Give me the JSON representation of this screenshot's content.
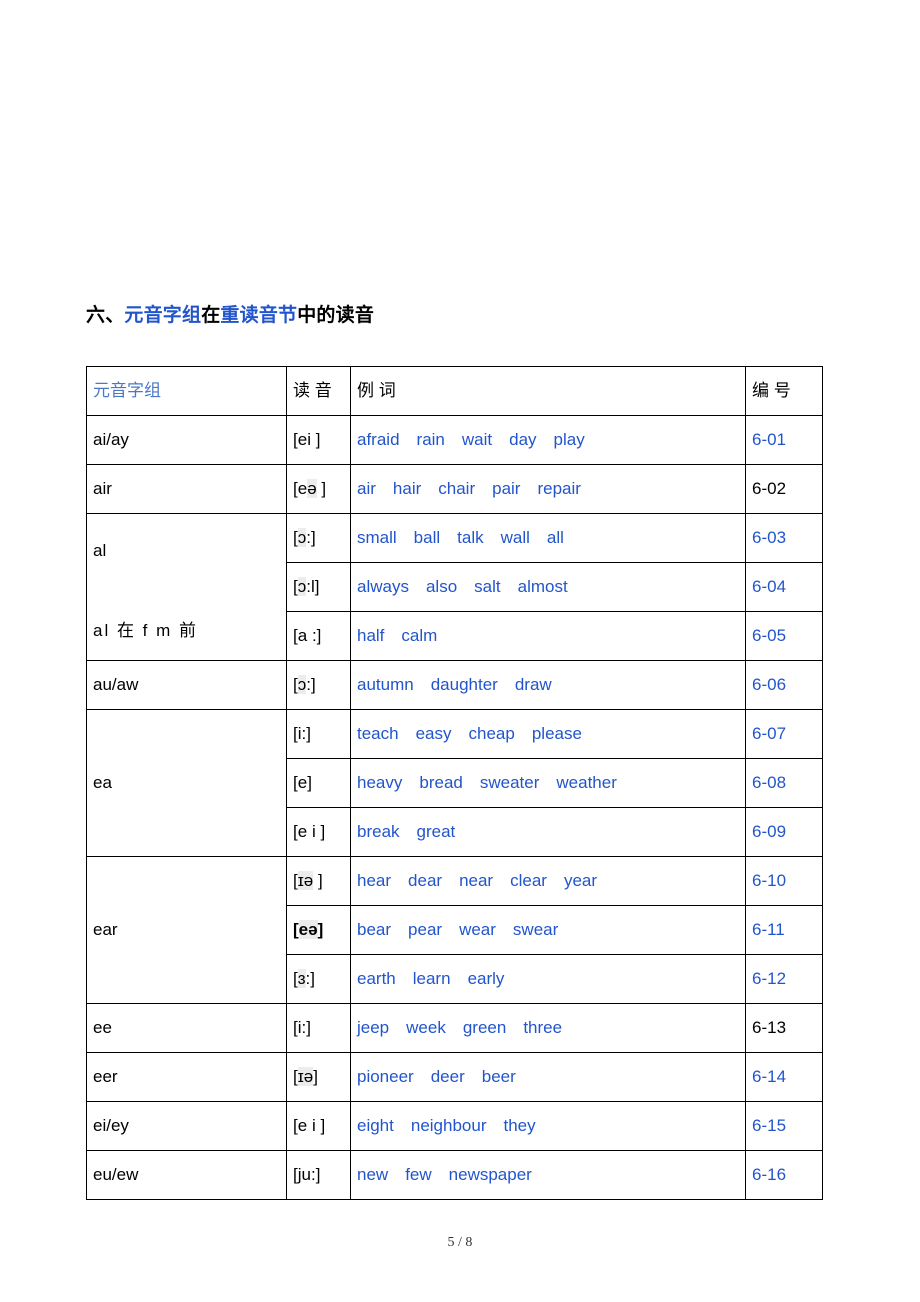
{
  "heading": {
    "prefix": "六、",
    "part1_blue": "元音字组",
    "part2_black": "在",
    "part3_blue": "重读音节",
    "part4_black": "中的读音"
  },
  "table": {
    "headers": {
      "group": "元音字组",
      "sound": "读 音",
      "words": "例 词",
      "code": "编 号"
    },
    "rows": [
      {
        "group": "ai/ay",
        "group_rowspan": 1,
        "sound": "[ei ]",
        "sound_highlight": "",
        "words": [
          "afraid",
          "rain",
          "wait",
          "day",
          "play"
        ],
        "code": "6-01",
        "code_color": "blue"
      },
      {
        "group": "air",
        "group_rowspan": 1,
        "sound": "[eə ]",
        "sound_highlight": "ə",
        "words": [
          "air",
          "hair",
          "chair",
          "pair",
          "repair"
        ],
        "code": "6-02",
        "code_color": "black"
      },
      {
        "group": "al",
        "group_note": "al 在 f m 前",
        "group_rowspan": 3,
        "sound": "[ɔ:]",
        "sound_highlight": "ɔ",
        "words": [
          "small",
          "ball",
          "talk",
          "wall",
          "all"
        ],
        "code": "6-03",
        "code_color": "blue"
      },
      {
        "group": "",
        "group_rowspan": 0,
        "sound": "[ɔ:l]",
        "sound_highlight": "ɔ",
        "words": [
          "always",
          "also",
          "salt",
          "almost"
        ],
        "code": "6-04",
        "code_color": "blue"
      },
      {
        "group": "",
        "group_rowspan": 0,
        "sound": "[a :]",
        "sound_highlight": "",
        "words": [
          "half",
          "calm"
        ],
        "code": "6-05",
        "code_color": "blue"
      },
      {
        "group": "au/aw",
        "group_rowspan": 1,
        "sound": "[ɔ:]",
        "sound_highlight": "ɔ",
        "words": [
          "autumn",
          "daughter",
          "draw"
        ],
        "code": "6-06",
        "code_color": "blue"
      },
      {
        "group": "ea",
        "group_rowspan": 3,
        "sound": "[i:]",
        "sound_highlight": "",
        "words": [
          "teach",
          "easy",
          "cheap",
          "please"
        ],
        "code": "6-07",
        "code_color": "blue"
      },
      {
        "group": "",
        "group_rowspan": 0,
        "sound": "[e]",
        "sound_highlight": "",
        "words": [
          "heavy",
          "bread",
          "sweater",
          "weather"
        ],
        "code": "6-08",
        "code_color": "blue"
      },
      {
        "group": "",
        "group_rowspan": 0,
        "sound": "[e i ]",
        "sound_highlight": "",
        "words": [
          "break",
          "great"
        ],
        "code": "6-09",
        "code_color": "blue"
      },
      {
        "group": "ear",
        "group_rowspan": 3,
        "sound": "[ɪə ]",
        "sound_highlight": "ɪə",
        "words": [
          "hear",
          "dear",
          "near",
          "clear",
          "year"
        ],
        "code": "6-10",
        "code_color": "blue"
      },
      {
        "group": "",
        "group_rowspan": 0,
        "sound": "[eə]",
        "sound_highlight": "eə",
        "sound_bold": true,
        "words": [
          "bear",
          "pear",
          "wear",
          "swear"
        ],
        "code": "6-11",
        "code_color": "blue"
      },
      {
        "group": "",
        "group_rowspan": 0,
        "sound": "[ɜ:]",
        "sound_highlight": "ɜ",
        "words": [
          "earth",
          "learn",
          "early"
        ],
        "code": "6-12",
        "code_color": "blue"
      },
      {
        "group": "ee",
        "group_rowspan": 1,
        "sound": "[i:]",
        "sound_highlight": "",
        "words": [
          "jeep",
          "week",
          "green",
          "three"
        ],
        "code": "6-13",
        "code_color": "black"
      },
      {
        "group": "eer",
        "group_rowspan": 1,
        "sound": "[ɪə]",
        "sound_highlight": "ɪə",
        "words": [
          "pioneer",
          "deer",
          "beer"
        ],
        "code": "6-14",
        "code_color": "blue"
      },
      {
        "group": "ei/ey",
        "group_rowspan": 1,
        "sound": "[e i ]",
        "sound_highlight": "",
        "words": [
          "eight",
          "neighbour",
          "they"
        ],
        "code": "6-15",
        "code_color": "blue"
      },
      {
        "group": "eu/ew",
        "group_rowspan": 1,
        "sound": "[ju:]",
        "sound_highlight": "",
        "words": [
          "new",
          "few",
          "newspaper"
        ],
        "code": "6-16",
        "code_color": "blue"
      }
    ]
  },
  "footer": {
    "page_indicator": "5 / 8"
  },
  "colors": {
    "link_blue": "#2255cc",
    "header_blue": "#4a78c8",
    "highlight_gray": "#ececec",
    "text_black": "#000000"
  }
}
